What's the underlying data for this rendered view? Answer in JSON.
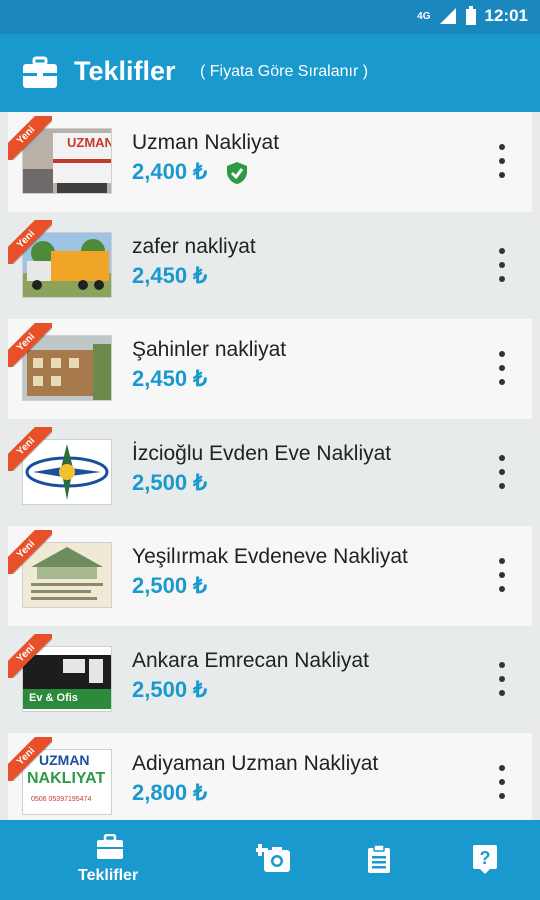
{
  "status": {
    "network": "4G",
    "time": "12:01"
  },
  "header": {
    "title": "Teklifler",
    "subtitle": "( Fiyata Göre Sıralanır )",
    "icon": "briefcase-icon"
  },
  "badge": "Yeni",
  "offers": [
    {
      "name": "Uzman Nakliyat",
      "price": "2,400 ₺",
      "verified": true
    },
    {
      "name": "zafer nakliyat",
      "price": "2,450 ₺",
      "verified": false
    },
    {
      "name": "Şahinler nakliyat",
      "price": "2,450 ₺",
      "verified": false
    },
    {
      "name": "İzcioğlu Evden Eve Nakliyat",
      "price": "2,500 ₺",
      "verified": false
    },
    {
      "name": "Yeşilırmak Evdeneve Nakliyat",
      "price": "2,500 ₺",
      "verified": false
    },
    {
      "name": "Ankara Emrecan Nakliyat",
      "price": "2,500 ₺",
      "verified": false
    },
    {
      "name": "Adiyaman Uzman Nakliyat",
      "price": "2,800 ₺",
      "verified": false
    }
  ],
  "thumbs": {
    "t1": "UZMAN",
    "t6": "Ev & Ofis",
    "t7a": "UZMAN",
    "t7b": "NAKLIYAT",
    "t7c": "0506 05397195474"
  },
  "nav": {
    "offers_label": "Teklifler"
  },
  "colors": {
    "primary": "#1a99cf",
    "price": "#1a99cf",
    "ribbon": "#e8502a",
    "verified": "#2e9a45"
  }
}
